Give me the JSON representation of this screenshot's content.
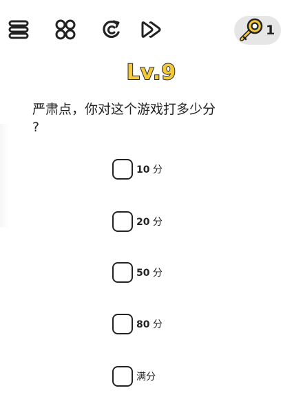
{
  "header": {
    "icons": [
      "menu-icon",
      "grid-icon",
      "restart-icon",
      "skip-icon",
      "key-icon"
    ],
    "key_count": "1"
  },
  "level": {
    "title": "Lv.9"
  },
  "question": {
    "line1": "严肃点，你对这个游戏打多少分",
    "line2": "?"
  },
  "options": [
    {
      "num": "10",
      "unit": " 分"
    },
    {
      "num": "20",
      "unit": " 分"
    },
    {
      "num": "50",
      "unit": " 分"
    },
    {
      "num": "80",
      "unit": " 分"
    },
    {
      "num": "",
      "unit": "满分"
    }
  ],
  "colors": {
    "title_fill": "#f3c93a",
    "key_gold": "#f3c93a",
    "pill_bg": "#e6e6e6",
    "outline": "#222222"
  }
}
